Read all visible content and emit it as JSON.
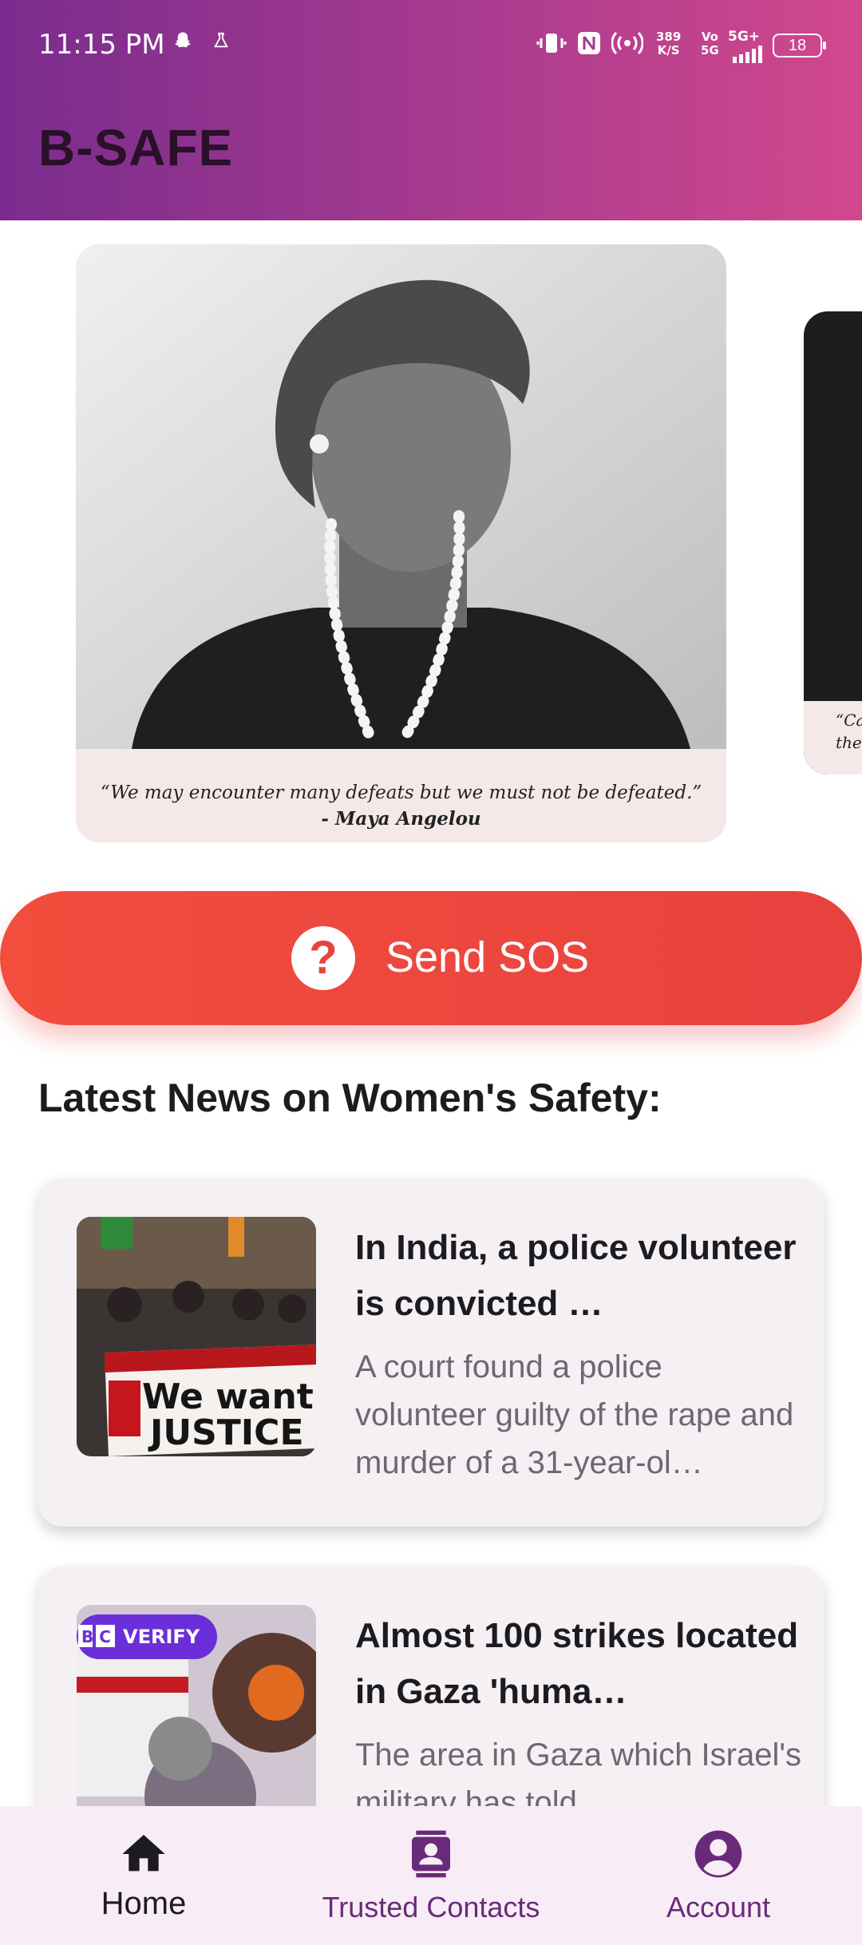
{
  "status_bar": {
    "time": "11:15 PM",
    "net_speed_value": "389",
    "net_speed_unit": "K/S",
    "vo_label": "Vo",
    "vo_sub": "5G",
    "network": "5G+",
    "battery": "18"
  },
  "app": {
    "title": "B-SAFE"
  },
  "quotes": [
    {
      "text": "“We may encounter many defeats but we must not be defeated.”",
      "author": "- Maya Angelou"
    },
    {
      "text_line1": "“Ca",
      "text_line2": "the"
    }
  ],
  "sos": {
    "label": "Send SOS",
    "icon": "?"
  },
  "news_section": {
    "heading": "Latest News on Women's Safety:"
  },
  "news": [
    {
      "title": "In India, a police volunteer is convicted …",
      "description": "A court found a police volunteer guilty of the rape and murder of a 31-year-ol…",
      "image_caption_1": "We want",
      "image_caption_2": "JUSTICE"
    },
    {
      "title": "Almost 100 strikes located in Gaza 'huma…",
      "description": "The area in Gaza which Israel's military has told",
      "badge_logo": "B C",
      "badge_text": "VERIFY"
    }
  ],
  "bottom_nav": {
    "home": "Home",
    "trusted_contacts": "Trusted Contacts",
    "account": "Account"
  },
  "colors": {
    "header_gradient_start": "#7a2c8e",
    "header_gradient_end": "#d2488e",
    "sos": "#e8423f",
    "nav_active": "#1c1b1f",
    "nav_inactive": "#6a2a7a"
  }
}
